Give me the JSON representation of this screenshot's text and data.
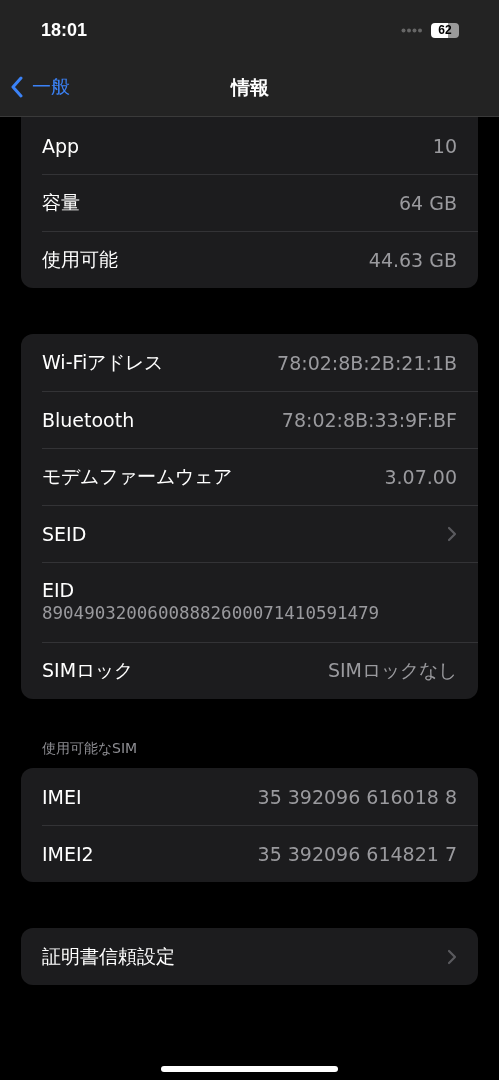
{
  "status_bar": {
    "time": "18:01",
    "battery": "62"
  },
  "nav": {
    "back": "一般",
    "title": "情報"
  },
  "groups": [
    {
      "rows": [
        {
          "kind": "value",
          "label": "App",
          "value": "10"
        },
        {
          "kind": "value",
          "label": "容量",
          "value": "64 GB"
        },
        {
          "kind": "value",
          "label": "使用可能",
          "value": "44.63 GB"
        }
      ]
    },
    {
      "rows": [
        {
          "kind": "value",
          "label": "Wi-Fiアドレス",
          "value": "78:02:8B:2B:21:1B"
        },
        {
          "kind": "value",
          "label": "Bluetooth",
          "value": "78:02:8B:33:9F:BF"
        },
        {
          "kind": "value",
          "label": "モデムファームウェア",
          "value": "3.07.00"
        },
        {
          "kind": "chevron",
          "label": "SEID"
        },
        {
          "kind": "stacked",
          "label": "EID",
          "value": "89049032006008882600071410591479"
        },
        {
          "kind": "value",
          "label": "SIMロック",
          "value": "SIMロックなし"
        }
      ]
    },
    {
      "header": "使用可能なSIM",
      "rows": [
        {
          "kind": "value",
          "label": "IMEI",
          "value": "35 392096 616018 8"
        },
        {
          "kind": "value",
          "label": "IMEI2",
          "value": "35 392096 614821 7"
        }
      ]
    },
    {
      "rows": [
        {
          "kind": "chevron",
          "label": "証明書信頼設定"
        }
      ]
    }
  ]
}
